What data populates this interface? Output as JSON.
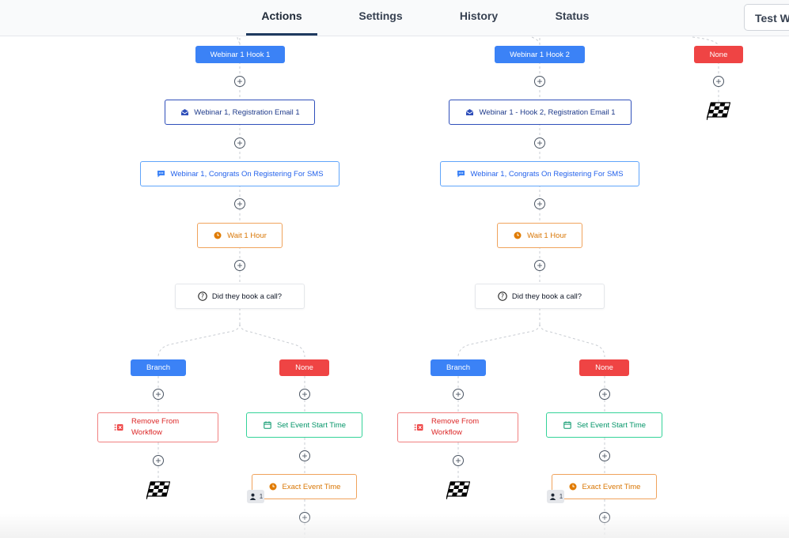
{
  "tabs": [
    {
      "label": "Actions",
      "active": true
    },
    {
      "label": "Settings",
      "active": false
    },
    {
      "label": "History",
      "active": false
    },
    {
      "label": "Status",
      "active": false
    }
  ],
  "test_button": "Test W",
  "columns": [
    {
      "trigger": "Webinar 1 Hook 1",
      "email": "Webinar 1, Registration Email 1",
      "sms": "Webinar 1, Congrats On Registering For SMS",
      "wait": "Wait 1 Hour",
      "condition": "Did they book a call?",
      "branch": {
        "label": "Branch",
        "action_line1": "Remove From",
        "action_line2": "Workflow"
      },
      "none": {
        "label": "None",
        "action": "Set Event Start Time",
        "wait": "Exact Event Time",
        "count": "1"
      }
    },
    {
      "trigger": "Webinar 1 Hook 2",
      "email": "Webinar 1 - Hook 2, Registration Email 1",
      "sms": "Webinar 1, Congrats On Registering For SMS",
      "wait": "Wait 1 Hour",
      "condition": "Did they book a call?",
      "branch": {
        "label": "Branch",
        "action_line1": "Remove From",
        "action_line2": "Workflow"
      },
      "none": {
        "label": "None",
        "action": "Set Event Start Time",
        "wait": "Exact Event Time",
        "count": "1"
      }
    }
  ],
  "third_trigger": "None",
  "colors": {
    "trigger_blue": "#3b82f6",
    "none_red": "#ef4444",
    "email_border": "#2f4fba",
    "sms_border": "#60a5fa",
    "wait_orange": "#f0a35c",
    "remove_red": "#f08080",
    "green": "#34d399"
  },
  "icons": {
    "email": "envelope-icon",
    "sms": "chat-bubble-icon",
    "wait": "clock-icon",
    "condition": "question-circle-icon",
    "remove": "remove-workflow-icon",
    "calendar": "calendar-icon",
    "end": "checkered-flag-icon",
    "add": "plus-circle-icon",
    "user": "user-icon"
  }
}
